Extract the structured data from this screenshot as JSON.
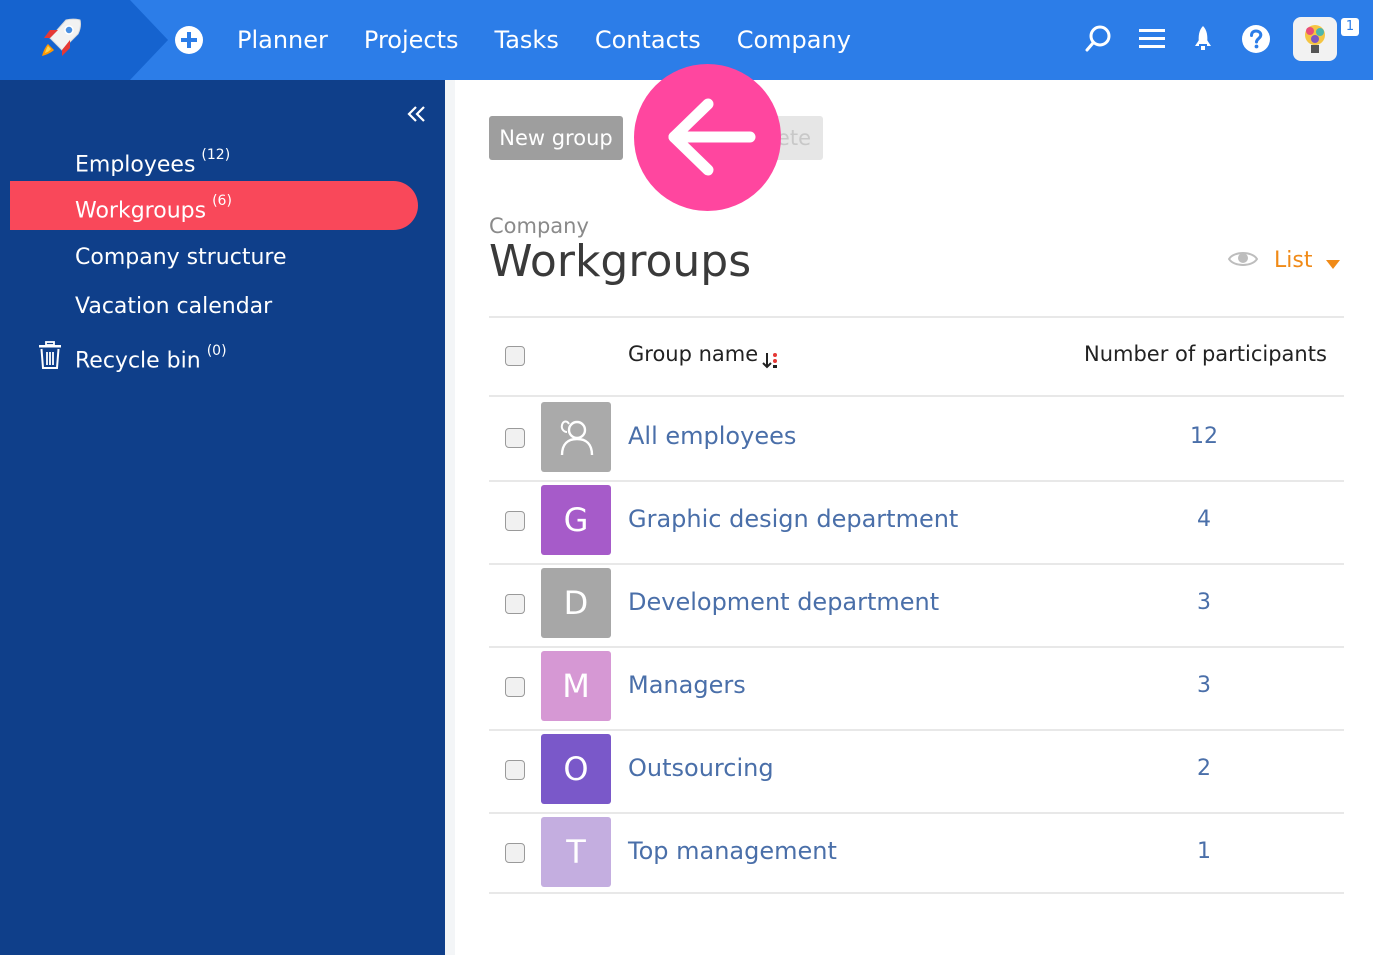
{
  "nav": {
    "items": [
      {
        "key": "planner",
        "label": "Planner"
      },
      {
        "key": "projects",
        "label": "Projects"
      },
      {
        "key": "tasks",
        "label": "Tasks"
      },
      {
        "key": "contacts",
        "label": "Contacts"
      },
      {
        "key": "company",
        "label": "Company"
      }
    ],
    "icons": [
      "plus-circle-icon",
      "search-icon",
      "menu-icon",
      "rocket-icon",
      "help-icon"
    ],
    "notification_count": "1"
  },
  "sidebar": {
    "items": [
      {
        "label": "Employees",
        "count": "(12)"
      },
      {
        "label": "Workgroups",
        "count": "(6)"
      },
      {
        "label": "Company structure",
        "count": ""
      },
      {
        "label": "Vacation calendar",
        "count": ""
      },
      {
        "label": "Recycle bin",
        "count": "(0)"
      }
    ],
    "active_index": 1
  },
  "toolbar": {
    "new_group_label": "New group",
    "delete_label": "ete"
  },
  "page": {
    "breadcrumb": "Company",
    "title": "Workgroups",
    "view_label": "List"
  },
  "table": {
    "col_name": "Group name",
    "col_count": "Number of participants",
    "rows": [
      {
        "letter": "",
        "name": "All employees",
        "count": "12",
        "color": "#aaaaaa"
      },
      {
        "letter": "G",
        "name": "Graphic design department",
        "count": "4",
        "color": "#a65bc9"
      },
      {
        "letter": "D",
        "name": "Development department",
        "count": "3",
        "color": "#a7a7a7"
      },
      {
        "letter": "M",
        "name": "Managers",
        "count": "3",
        "color": "#d698d4"
      },
      {
        "letter": "O",
        "name": "Outsourcing",
        "count": "2",
        "color": "#7a58c9"
      },
      {
        "letter": "T",
        "name": "Top management",
        "count": "1",
        "color": "#c4aee0"
      }
    ]
  },
  "colors": {
    "topbar": "#2c7de8",
    "sidebar": "#0f3f8a",
    "active": "#f9485a",
    "accent_orange": "#f08a17",
    "highlight_circle": "#ff469f",
    "link": "#4a6fa9"
  }
}
